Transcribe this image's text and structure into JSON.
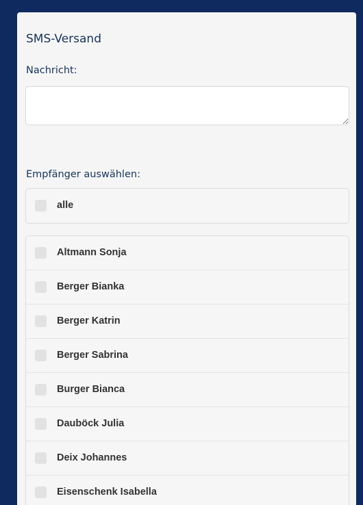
{
  "sms": {
    "title": "SMS-Versand",
    "message_label": "Nachricht:",
    "message_value": "",
    "recipients_label": "Empfänger auswählen:",
    "select_all_label": "alle",
    "recipients": [
      "Altmann Sonja",
      "Berger Bianka",
      "Berger Katrin",
      "Berger Sabrina",
      "Burger Bianca",
      "Dauböck Julia",
      "Deix Johannes",
      "Eisenschenk Isabella"
    ]
  },
  "colors": {
    "page_background": "#0e2a5e",
    "panel_background": "#f5f5f5",
    "heading_color": "#15335e",
    "item_text": "#333333"
  }
}
